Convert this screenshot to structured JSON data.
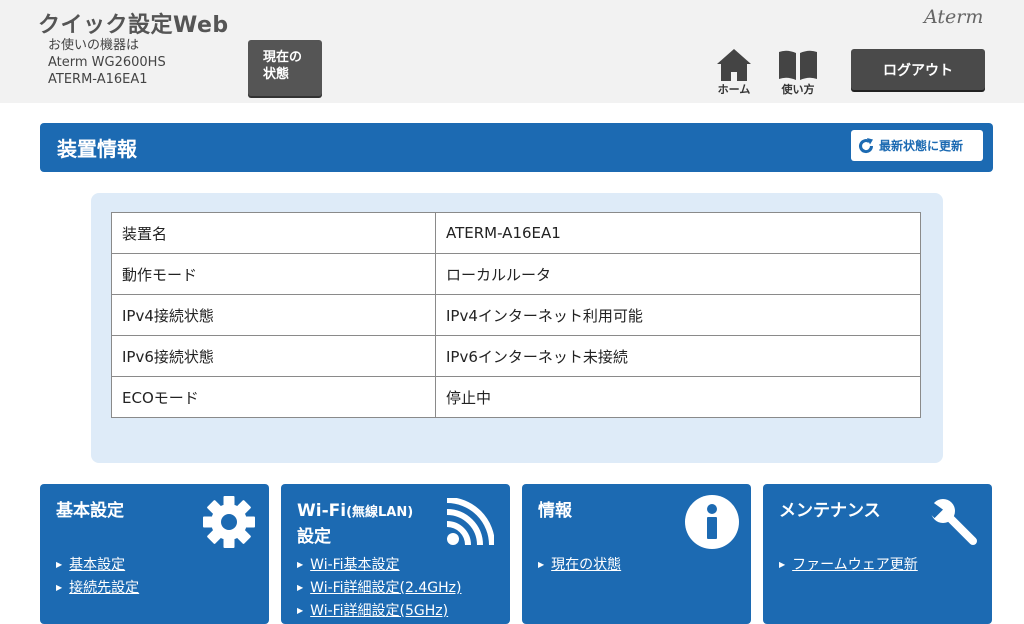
{
  "header": {
    "app_title": "クイック設定Web",
    "device_label": "お使いの機器は",
    "device_model": "Aterm WG2600HS",
    "device_name": "ATERM-A16EA1",
    "status_button": [
      "現在の",
      "状態"
    ],
    "brand": "Aterm",
    "nav": {
      "home_label": "ホーム",
      "help_label": "使い方"
    },
    "logout_label": "ログアウト"
  },
  "section": {
    "title": "装置情報",
    "refresh_label": "最新状態に更新"
  },
  "device_info": {
    "rows": [
      {
        "key": "装置名",
        "value": "ATERM-A16EA1"
      },
      {
        "key": "動作モード",
        "value": "ローカルルータ"
      },
      {
        "key": "IPv4接続状態",
        "value": "IPv4インターネット利用可能"
      },
      {
        "key": "IPv6接続状態",
        "value": "IPv6インターネット未接続"
      },
      {
        "key": "ECOモード",
        "value": "停止中"
      }
    ]
  },
  "cards": [
    {
      "title": "基本設定",
      "icon": "gear-icon",
      "links": [
        "基本設定",
        "接続先設定"
      ]
    },
    {
      "title_main": "Wi-Fi",
      "title_sub": "(無線LAN)",
      "title_line2": "設定",
      "icon": "wifi-icon",
      "links": [
        "Wi-Fi基本設定",
        "Wi-Fi詳細設定(2.4GHz)",
        "Wi-Fi詳細設定(5GHz)"
      ]
    },
    {
      "title": "情報",
      "icon": "info-icon",
      "links": [
        "現在の状態"
      ]
    },
    {
      "title": "メンテナンス",
      "icon": "wrench-icon",
      "links": [
        "ファームウェア更新"
      ]
    }
  ],
  "colors": {
    "accent": "#1c6ab2",
    "panel": "#deebf8",
    "header_bg": "#f2f2f2",
    "dark_button": "#4a4a4a"
  }
}
